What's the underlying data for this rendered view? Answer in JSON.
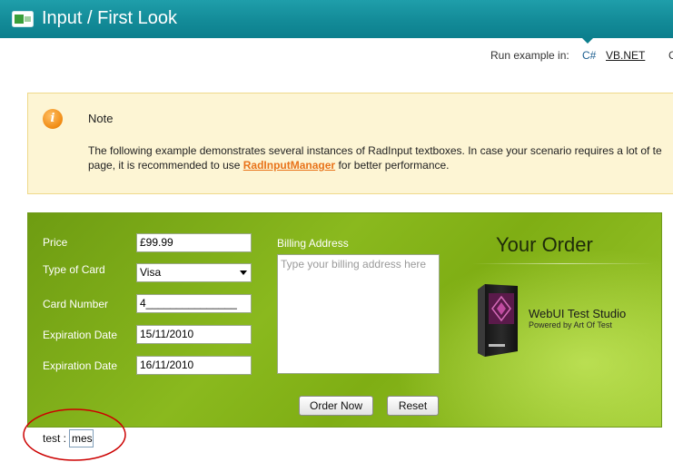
{
  "header": {
    "title": "Input / First Look",
    "icon": "input-control-icon"
  },
  "run_example": {
    "label": "Run example in:",
    "languages": [
      "C#",
      "VB.NET"
    ],
    "truncated": "C"
  },
  "note": {
    "title": "Note",
    "icon": "info-icon",
    "text_before": "The following example demonstrates several instances of RadInput textboxes. In case your scenario requires a lot of te",
    "text_line2_before": "page, it is recommended to use ",
    "link": "RadInputManager",
    "text_after": " for better performance."
  },
  "form": {
    "price": {
      "label": "Price",
      "value": "£99.99"
    },
    "card_type": {
      "label": "Type of Card",
      "value": "Visa"
    },
    "card_number": {
      "label": "Card Number",
      "value": "4_______________"
    },
    "expiration_1": {
      "label": "Expiration Date",
      "value": "15/11/2010"
    },
    "expiration_2": {
      "label": "Expiration Date",
      "value": "16/11/2010"
    },
    "billing": {
      "label": "Billing Address",
      "placeholder": "Type your billing address here"
    },
    "order_now": "Order Now",
    "reset": "Reset"
  },
  "order": {
    "title": "Your Order",
    "product_name": "WebUI Test Studio",
    "product_sub": "Powered by Art Of Test"
  },
  "test": {
    "label": "test :",
    "value": "mes"
  },
  "colors": {
    "header": "#138b98",
    "panel": "#8ab91e",
    "link": "#e8731a",
    "annotation": "#cc0000"
  }
}
